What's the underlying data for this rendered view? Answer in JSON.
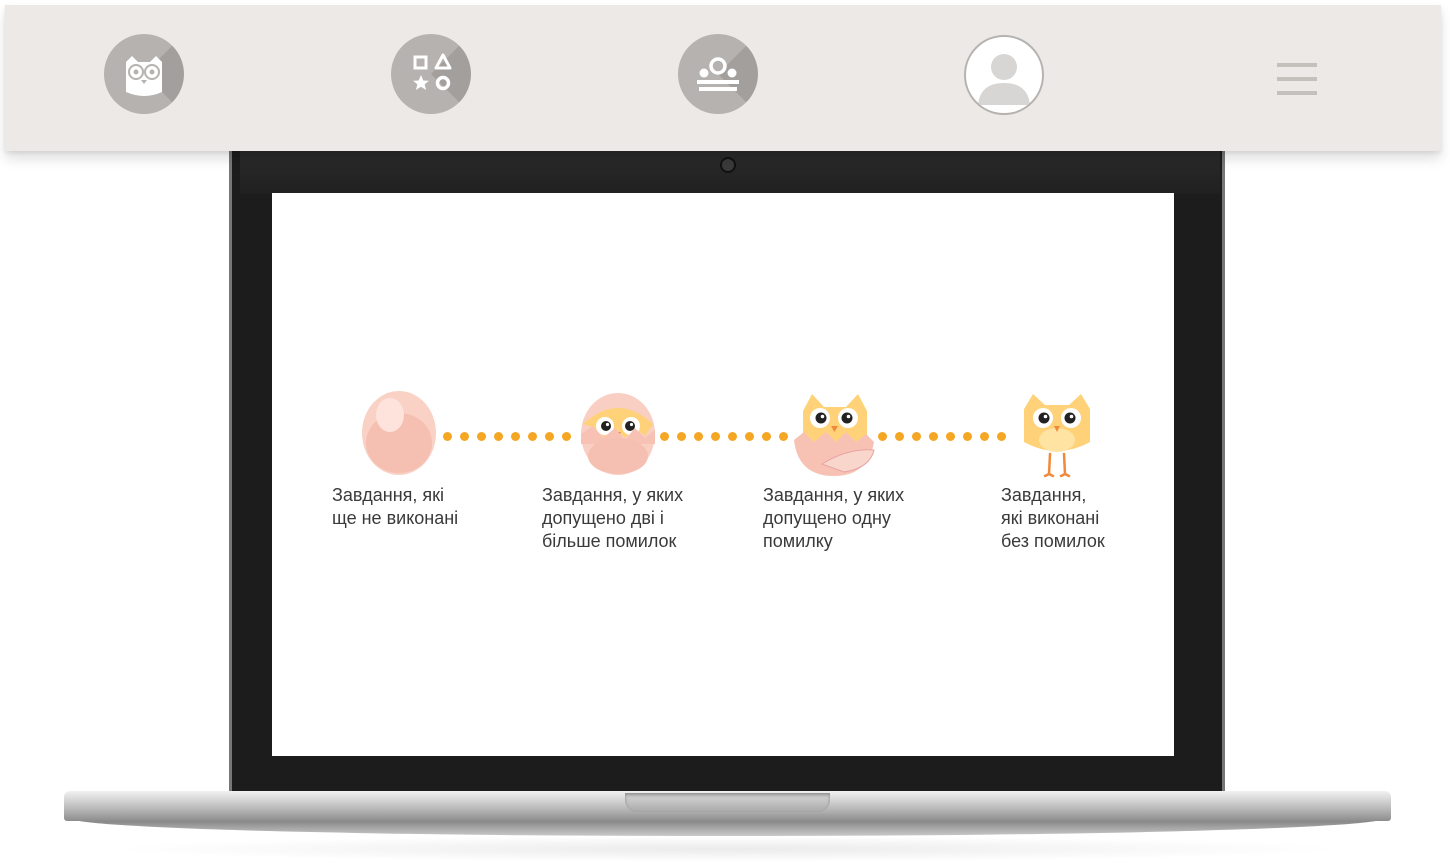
{
  "nav": {
    "items": [
      {
        "name": "owl-icon"
      },
      {
        "name": "shapes-icon"
      },
      {
        "name": "podium-icon"
      },
      {
        "name": "user-avatar-icon"
      }
    ],
    "menu_icon": "hamburger-menu-icon"
  },
  "colors": {
    "topbar_bg": "#ede9e6",
    "nav_circle": "#b5b2af",
    "progress_dots": "#f5a623",
    "egg": "#f7cfc4",
    "chick": "#ffd27a"
  },
  "legend": {
    "stages": [
      {
        "icon": "egg-icon",
        "lines": [
          "Завдання, які",
          "ще не виконані"
        ]
      },
      {
        "icon": "hatching-owl-icon",
        "lines": [
          "Завдання, у яких",
          "допущено дві і",
          "більше помилок"
        ]
      },
      {
        "icon": "half-hatched-owl-icon",
        "lines": [
          "Завдання, у яких",
          "допущено одну",
          "помилку"
        ]
      },
      {
        "icon": "owl-chick-icon",
        "lines": [
          "Завдання,",
          "які виконані",
          "без помилок"
        ]
      }
    ]
  }
}
